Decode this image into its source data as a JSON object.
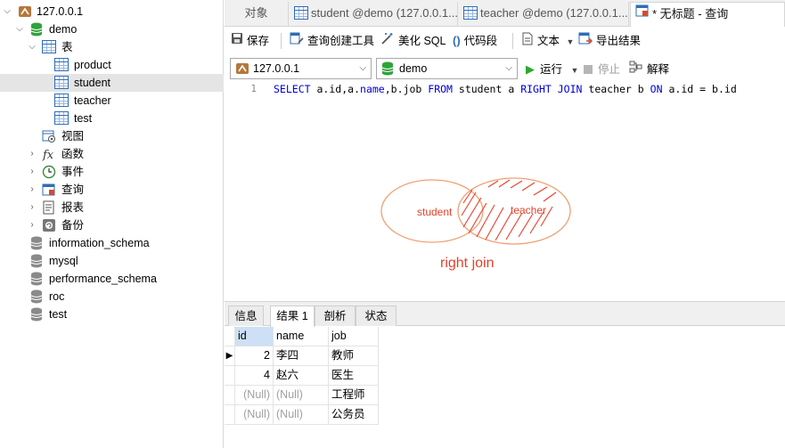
{
  "sidebar": {
    "connection": "127.0.0.1",
    "database": "demo",
    "tables_group": "表",
    "tables": [
      "product",
      "student",
      "teacher",
      "test"
    ],
    "selected_table": "student",
    "groups": [
      "视图",
      "函数",
      "事件",
      "查询",
      "报表",
      "备份"
    ],
    "other_databases": [
      "information_schema",
      "mysql",
      "performance_schema",
      "roc",
      "test"
    ]
  },
  "tabs": [
    {
      "label": "对象"
    },
    {
      "label": "student @demo (127.0.0.1..."
    },
    {
      "label": "teacher @demo (127.0.0.1..."
    },
    {
      "label": "* 无标题 - 查询"
    }
  ],
  "toolbar": {
    "save": "保存",
    "query_builder": "查询创建工具",
    "beautify": "美化 SQL",
    "snippet": "代码段",
    "text": "文本",
    "export": "导出结果"
  },
  "connbar": {
    "connection": "127.0.0.1",
    "database": "demo",
    "run": "运行",
    "stop": "停止",
    "explain": "解释"
  },
  "editor": {
    "line_number": "1",
    "sql": "SELECT a.id,a.name,b.job FROM student a RIGHT JOIN teacher b ON a.id = b.id"
  },
  "diagram": {
    "left_label": "student",
    "right_label": "teacher",
    "caption": "right join",
    "color": "#e8402a",
    "ellipse_color": "#f0a070"
  },
  "results": {
    "tabs": [
      "信息",
      "结果 1",
      "剖析",
      "状态"
    ],
    "active_tab": "结果 1",
    "columns": [
      "id",
      "name",
      "job"
    ],
    "rows": [
      [
        "2",
        "李四",
        "教师"
      ],
      [
        "4",
        "赵六",
        "医生"
      ],
      [
        "(Null)",
        "(Null)",
        "工程师"
      ],
      [
        "(Null)",
        "(Null)",
        "公务员"
      ]
    ]
  }
}
